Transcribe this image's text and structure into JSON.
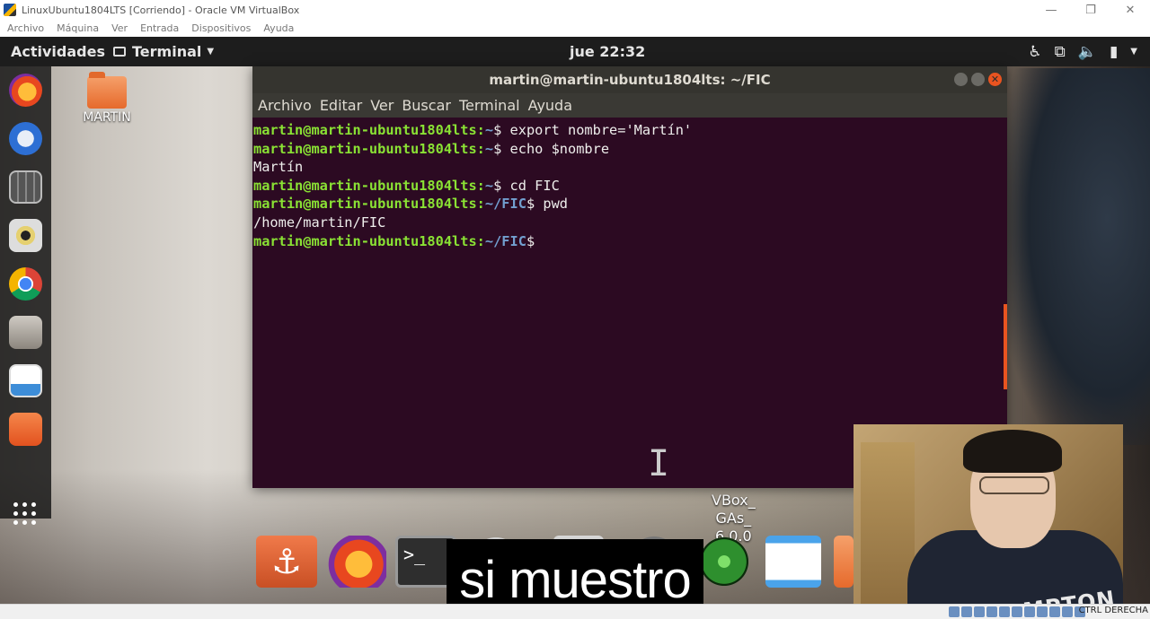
{
  "host_window": {
    "title": "LinuxUbuntu1804LTS [Corriendo] - Oracle VM VirtualBox",
    "menu": [
      "Archivo",
      "Máquina",
      "Ver",
      "Entrada",
      "Dispositivos",
      "Ayuda"
    ],
    "status_hostkey": "CTRL DERECHA"
  },
  "topbar": {
    "activities": "Actividades",
    "app_menu": "Terminal",
    "clock": "jue 22:32"
  },
  "desktop": {
    "folder_label": "MARTIN",
    "vbox_label_line1": "VBox_",
    "vbox_label_line2": "GAs_",
    "vbox_label_line3": "6.0.0"
  },
  "terminal": {
    "title": "martin@martin-ubuntu1804lts: ~/FIC",
    "menu": [
      "Archivo",
      "Editar",
      "Ver",
      "Buscar",
      "Terminal",
      "Ayuda"
    ],
    "prompt_user": "martin@martin-ubuntu1804lts",
    "lines": [
      {
        "path": "~",
        "cmd": " export nombre='Martín'"
      },
      {
        "path": "~",
        "cmd": " echo $nombre"
      },
      {
        "output": "Martín"
      },
      {
        "path": "~",
        "cmd": " cd FIC"
      },
      {
        "path": "~/FIC",
        "cmd": " pwd"
      },
      {
        "output": "/home/martin/FIC"
      },
      {
        "path": "~/FIC",
        "cmd": ""
      }
    ]
  },
  "webcam": {
    "shirt_text": "HAMPTON"
  },
  "subtitle": "si muestro",
  "colors": {
    "terminal_bg": "#2c0a22",
    "prompt_user": "#8ae234",
    "prompt_path": "#729fcf",
    "ubuntu_orange": "#e95420"
  }
}
